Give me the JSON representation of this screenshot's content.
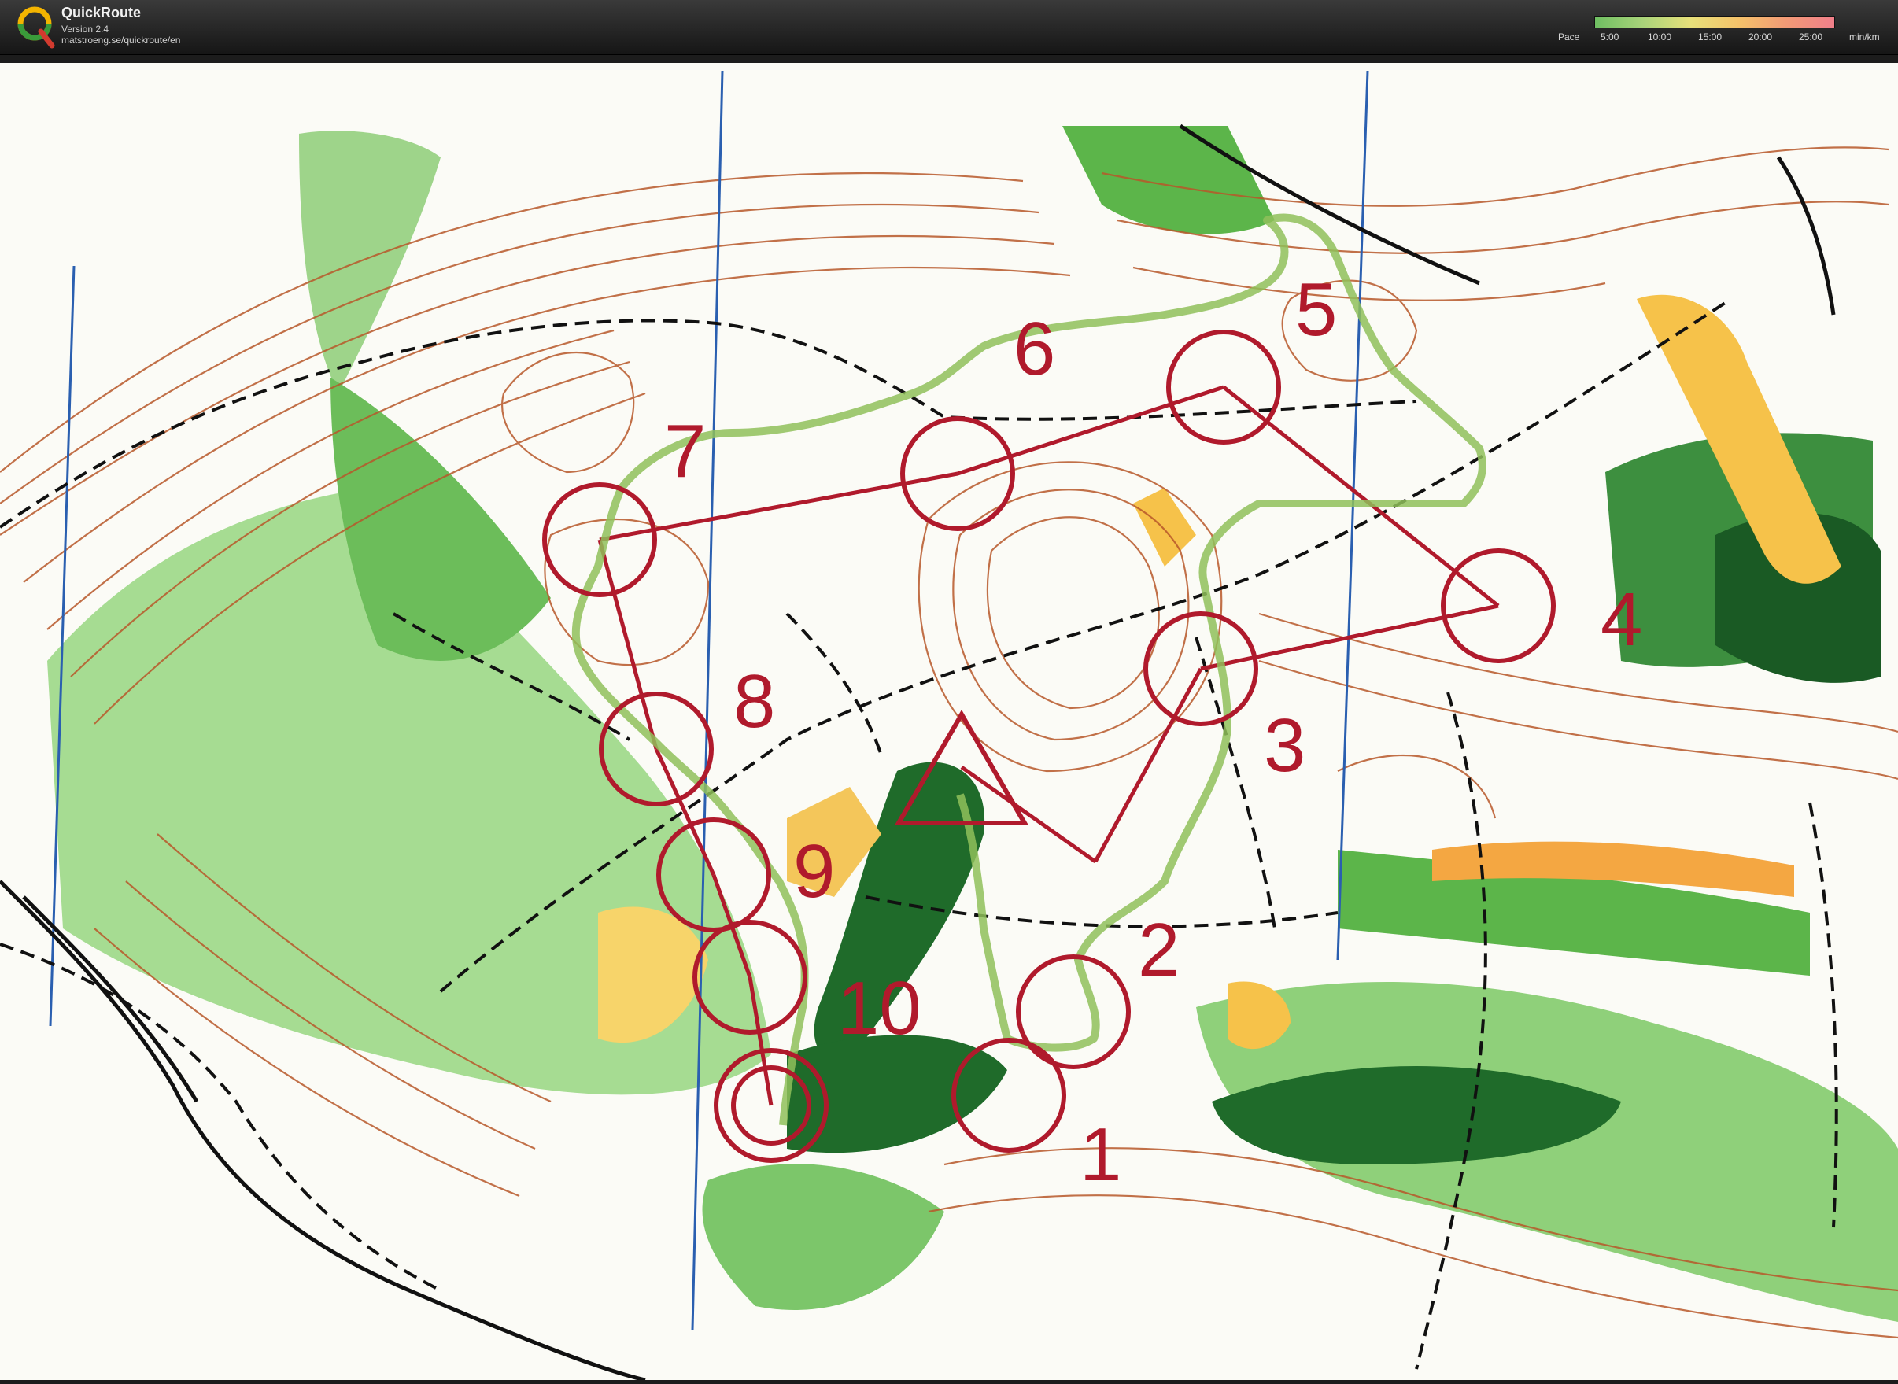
{
  "app": {
    "name": "QuickRoute",
    "version": "Version 2.4",
    "url": "matstroeng.se/quickroute/en"
  },
  "legend": {
    "label": "Pace",
    "ticks": [
      "5:00",
      "10:00",
      "15:00",
      "20:00",
      "25:00"
    ],
    "unit": "min/km",
    "colors": [
      "#6fbf62",
      "#a9d47a",
      "#e7e07a",
      "#f4c26a",
      "#f29a76",
      "#f07f8a"
    ]
  },
  "map": {
    "colors": {
      "contour": "#b8582a",
      "forest_light": "#9fd68c",
      "forest_mid": "#5cb54a",
      "forest_dark": "#1f6b2a",
      "open_yellow": "#f6c24a",
      "course": "#b01a2c",
      "route": "#8fbf5a",
      "path": "#111111",
      "grid": "#2a5fb0"
    },
    "controls": [
      {
        "number": "1"
      },
      {
        "number": "2"
      },
      {
        "number": "3"
      },
      {
        "number": "4"
      },
      {
        "number": "5"
      },
      {
        "number": "6"
      },
      {
        "number": "7"
      },
      {
        "number": "8"
      },
      {
        "number": "9"
      },
      {
        "number": "10"
      }
    ]
  }
}
